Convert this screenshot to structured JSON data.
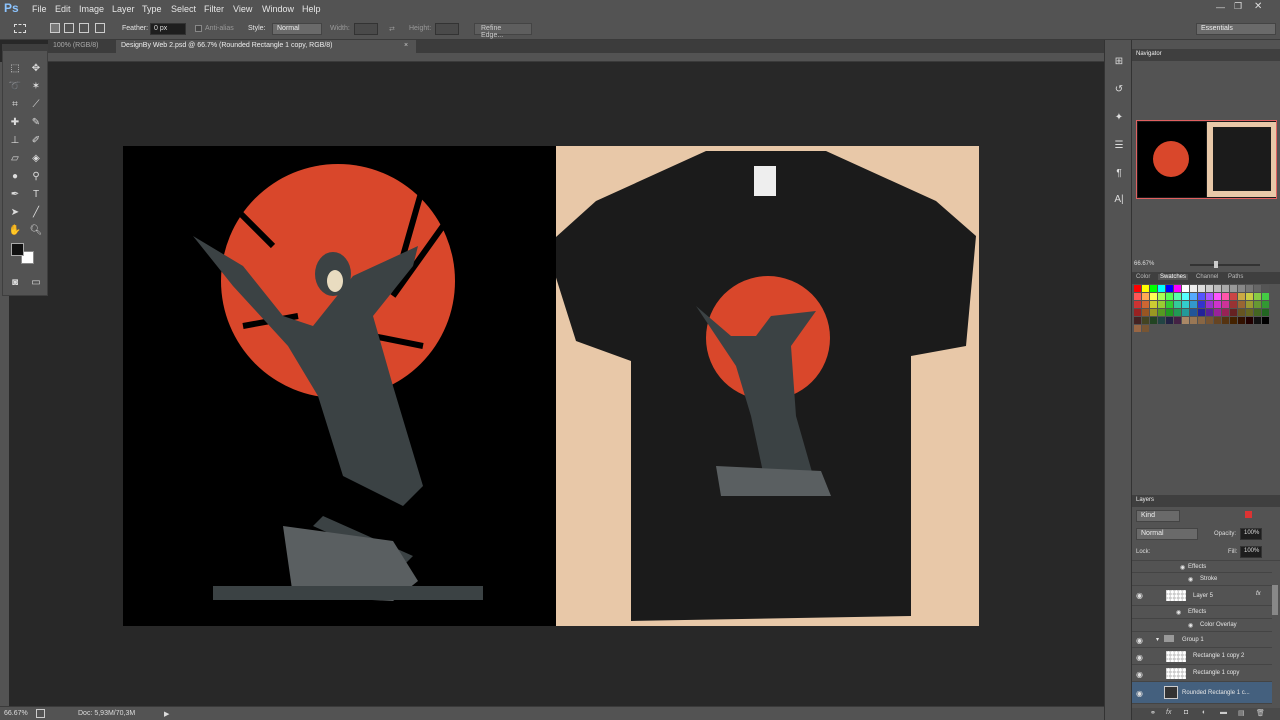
{
  "app": {
    "logo": "Ps"
  },
  "menu": [
    "File",
    "Edit",
    "Image",
    "Layer",
    "Type",
    "Select",
    "Filter",
    "View",
    "Window",
    "Help"
  ],
  "options": {
    "feather_label": "Feather:",
    "feather_value": "0 px",
    "antialias_label": "Anti-alias",
    "style_label": "Style:",
    "style_value": "Normal",
    "width_label": "Width:",
    "height_label": "Height:",
    "refine_label": "Refine Edge...",
    "workspace": "Essentials"
  },
  "tabs": [
    {
      "label": "100% (RGB/8)"
    },
    {
      "label": "DesignBy Web 2.psd @ 66.7% (Rounded Rectangle 1 copy, RGB/8)"
    }
  ],
  "status": {
    "zoom": "66.67%",
    "doc": "Doc: 5,93M/70,3M"
  },
  "navigator": {
    "title": "Navigator",
    "zoom": "66.67%"
  },
  "swatches": {
    "tabs": [
      "Color",
      "Swatches",
      "Channel",
      "Paths"
    ]
  },
  "layers": {
    "title": "Layers",
    "filter": "Kind",
    "blend": "Normal",
    "opacity_label": "Opacity:",
    "opacity": "100%",
    "lock_label": "Lock:",
    "fill_label": "Fill:",
    "fill": "100%",
    "rows": [
      {
        "name": "Effects"
      },
      {
        "name": "Stroke"
      },
      {
        "name": "Layer 5"
      },
      {
        "name": "Effects"
      },
      {
        "name": "Color Overlay"
      },
      {
        "name": "Group 1"
      },
      {
        "name": "Rectangle 1 copy 2"
      },
      {
        "name": "Rectangle 1 copy"
      },
      {
        "name": "Rounded Rectangle 1 c..."
      }
    ]
  },
  "colors": {
    "accent": "#d9472b",
    "tan": "#e8c8a8",
    "panel": "#535353"
  }
}
